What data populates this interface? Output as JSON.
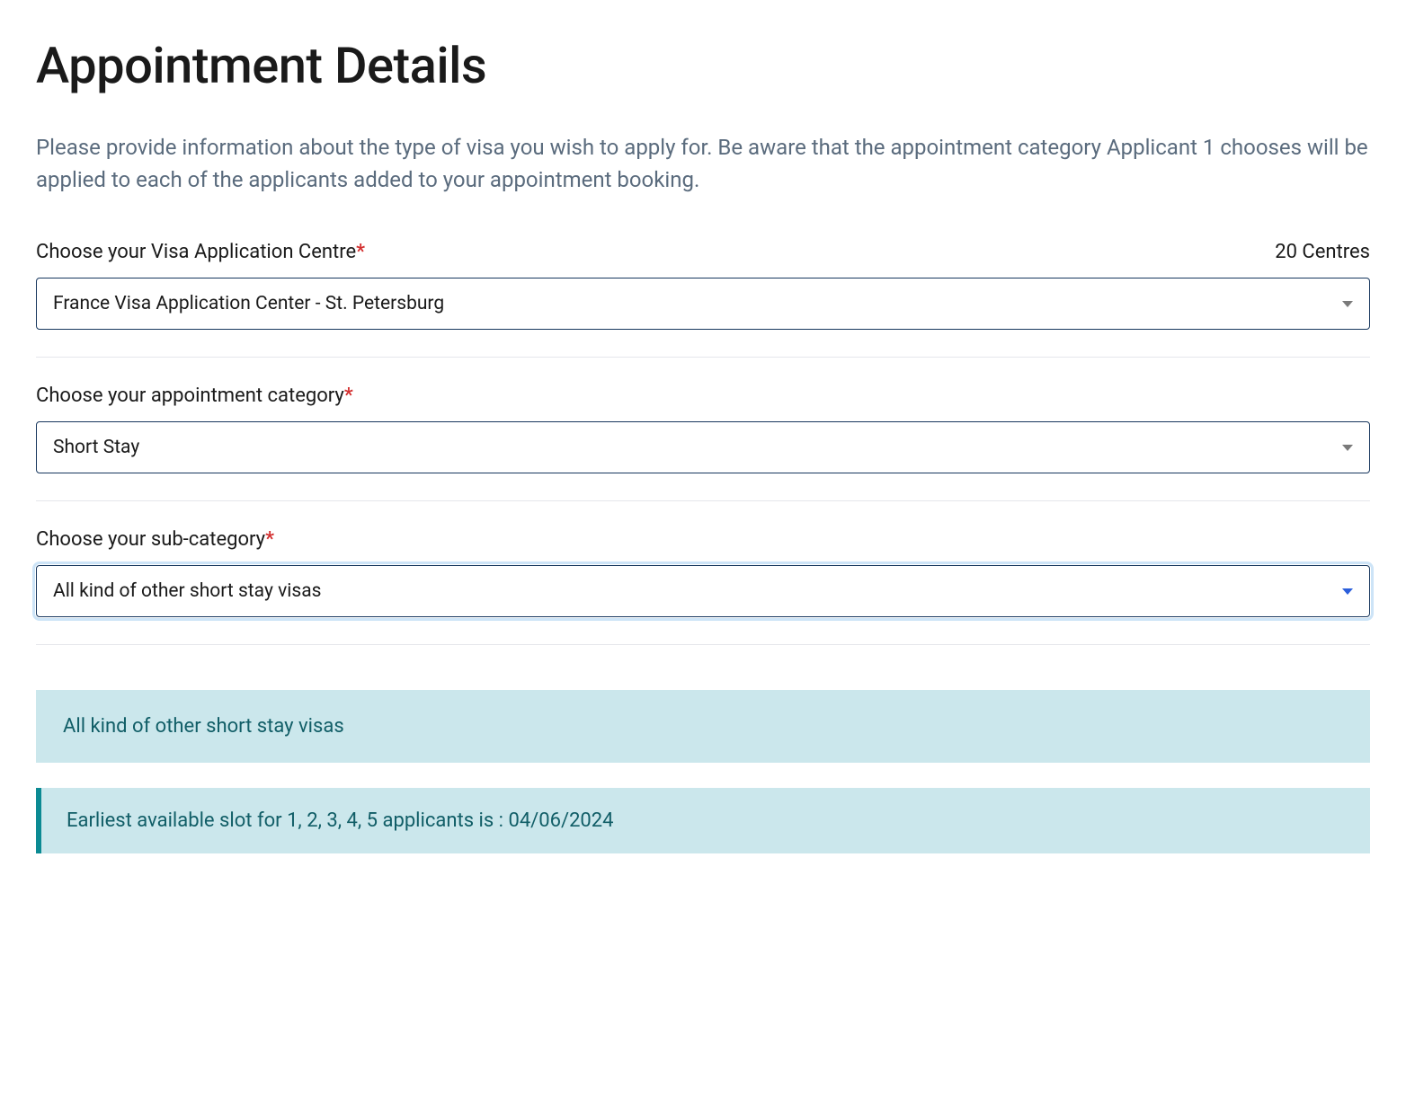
{
  "header": {
    "title": "Appointment Details",
    "description": "Please provide information about the type of visa you wish to apply for. Be aware that the appointment category Applicant 1 chooses will be applied to each of the applicants added to your appointment booking."
  },
  "fields": {
    "centre": {
      "label": "Choose your Visa Application Centre",
      "count_label": "20 Centres",
      "selected": "France Visa Application Center - St. Petersburg"
    },
    "category": {
      "label": "Choose your appointment category",
      "selected": "Short Stay"
    },
    "subcategory": {
      "label": "Choose your sub-category",
      "selected": "All kind of other short stay visas"
    }
  },
  "info": {
    "visa_type_title": "All kind of other short stay visas",
    "slot_message": "Earliest available slot for 1, 2, 3, 4, 5 applicants is : 04/06/2024"
  }
}
